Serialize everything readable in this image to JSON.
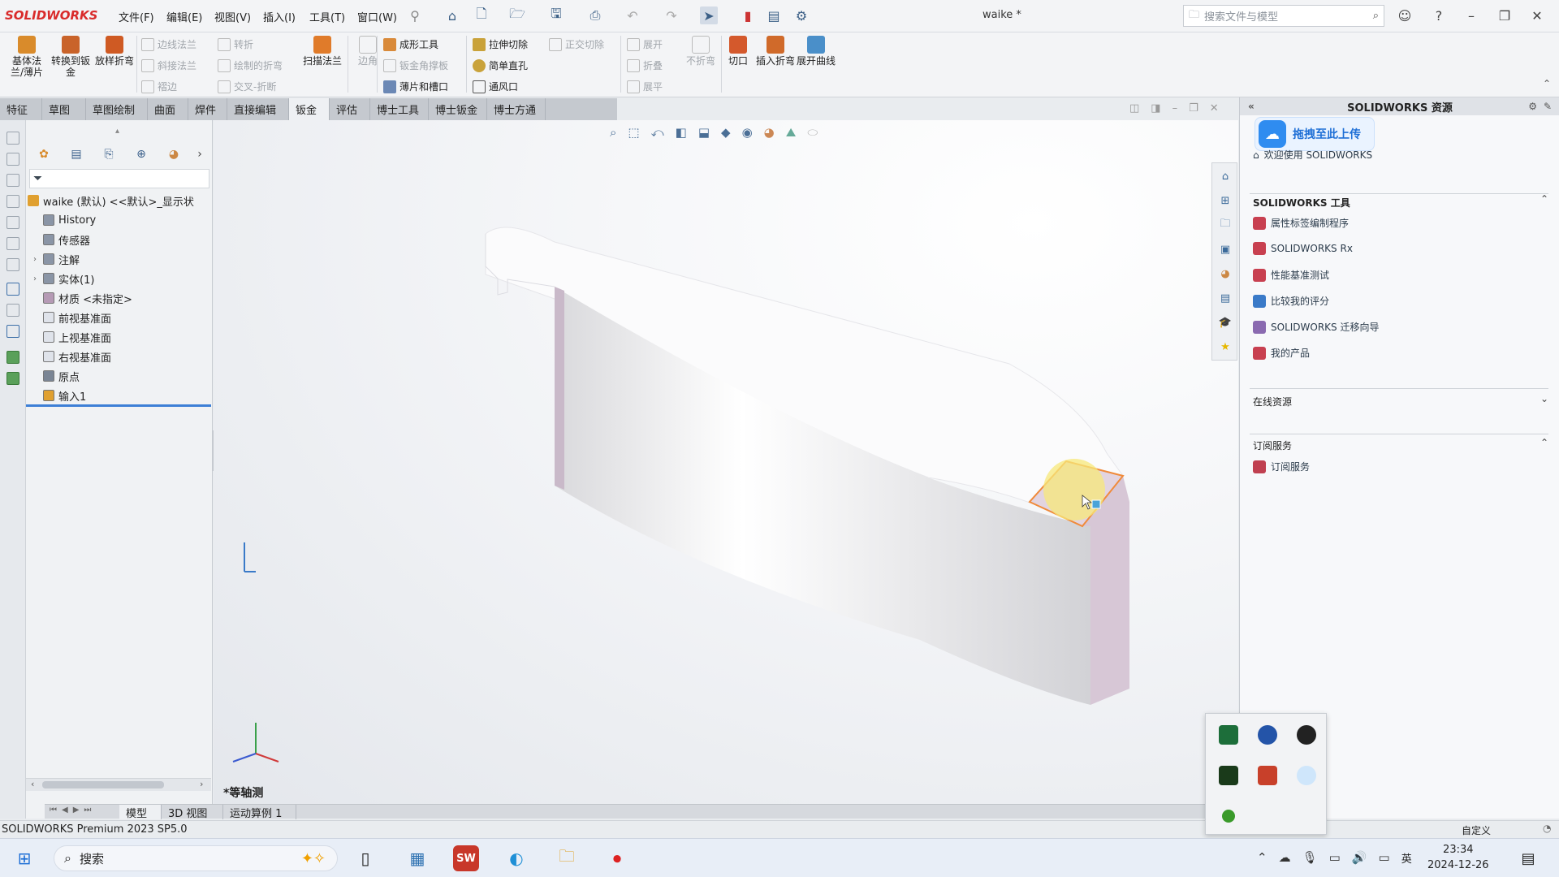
{
  "app": {
    "logo": "SOLIDWORKS",
    "doc_title": "waike *"
  },
  "menu": [
    "文件(F)",
    "编辑(E)",
    "视图(V)",
    "插入(I)",
    "工具(T)",
    "窗口(W)"
  ],
  "search": {
    "placeholder": "搜索文件与模型"
  },
  "ribbon": {
    "big": [
      {
        "label": "基体法兰/薄片",
        "color": "#d98b2b"
      },
      {
        "label": "转换到钣金",
        "color": "#c9632a"
      },
      {
        "label": "放样折弯",
        "color": "#cf5a23"
      }
    ],
    "col1": [
      "边线法兰",
      "斜接法兰",
      "褶边"
    ],
    "col2": [
      "转折",
      "绘制的折弯",
      "交叉-折断"
    ],
    "mid_big": {
      "label": "扫描法兰",
      "color": "#e07b2a"
    },
    "col3_label": "边角",
    "col4": [
      "成形工具",
      "钣金角撑板",
      "薄片和槽口"
    ],
    "col5": [
      "拉伸切除",
      "简单直孔",
      "通风口"
    ],
    "col5b": "正交切除",
    "col6": [
      "展开",
      "折叠",
      "展平"
    ],
    "col6b": "不折弯",
    "right_big": [
      {
        "label": "切口",
        "color": "#d4592c"
      },
      {
        "label": "插入折弯",
        "color": "#d06a2a"
      },
      {
        "label": "展开曲线",
        "color": "#4a8fc9"
      }
    ]
  },
  "tabs": [
    {
      "label": "特征",
      "active": false
    },
    {
      "label": "草图",
      "active": false
    },
    {
      "label": "草图绘制",
      "active": false
    },
    {
      "label": "曲面",
      "active": false
    },
    {
      "label": "焊件",
      "active": false
    },
    {
      "label": "直接编辑",
      "active": false
    },
    {
      "label": "钣金",
      "active": true
    },
    {
      "label": "评估",
      "active": false
    },
    {
      "label": "博士工具",
      "active": false
    },
    {
      "label": "博士钣金",
      "active": false
    },
    {
      "label": "博士方通",
      "active": false
    }
  ],
  "tree": {
    "root": "waike (默认) <<默认>_显示状",
    "items": [
      {
        "label": "History",
        "expandable": false
      },
      {
        "label": "传感器",
        "expandable": false
      },
      {
        "label": "注解",
        "expandable": true
      },
      {
        "label": "实体(1)",
        "expandable": true
      },
      {
        "label": "材质 <未指定>",
        "expandable": false
      },
      {
        "label": "前视基准面",
        "expandable": false
      },
      {
        "label": "上视基准面",
        "expandable": false
      },
      {
        "label": "右视基准面",
        "expandable": false
      },
      {
        "label": "原点",
        "expandable": false
      },
      {
        "label": "输入1",
        "expandable": false
      }
    ]
  },
  "viewport": {
    "view_label": "*等轴测"
  },
  "bottom_tabs": [
    {
      "label": "模型",
      "active": true
    },
    {
      "label": "3D 视图",
      "active": false
    },
    {
      "label": "运动算例 1",
      "active": false
    }
  ],
  "status": {
    "left": "SOLIDWORKS Premium 2023 SP5.0",
    "right": "自定义"
  },
  "resources": {
    "title": "SOLIDWORKS 资源",
    "upload_label": "拖拽至此上传",
    "welcome": "欢迎使用 SOLIDWORKS",
    "tools_title": "SOLIDWORKS 工具",
    "tools": [
      "属性标签编制程序",
      "SOLIDWORKS Rx",
      "性能基准测试",
      "比较我的评分",
      "SOLIDWORKS 迁移向导",
      "我的产品"
    ],
    "online_title": "在线资源",
    "sub_title": "订阅服务",
    "sub_items": [
      "订阅服务"
    ]
  },
  "taskbar": {
    "search_label": "搜索",
    "time": "23:34",
    "date": "2024-12-26",
    "ime": "英"
  }
}
